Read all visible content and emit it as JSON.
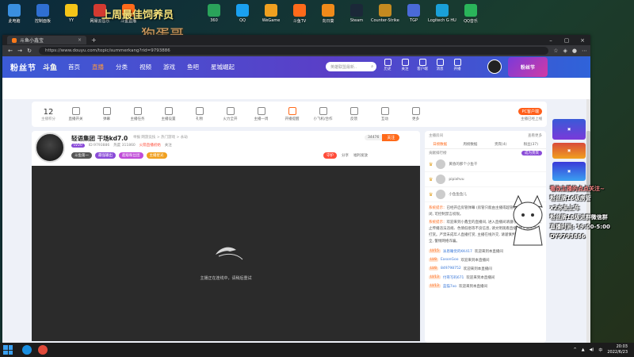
{
  "desktop": {
    "icons": [
      {
        "label": "此电脑",
        "color": "#3a8fe0"
      },
      {
        "label": "控制面板",
        "color": "#2f6fd1"
      },
      {
        "label": "YY",
        "color": "#f5c518"
      },
      {
        "label": "网易云音乐",
        "color": "#d33a31"
      },
      {
        "label": "斗鱼直播",
        "color": "#ff6a1a"
      },
      {
        "label": "",
        "color": "transparent"
      },
      {
        "label": "",
        "color": "transparent"
      },
      {
        "label": "360",
        "color": "#2aa35a"
      },
      {
        "label": "QQ",
        "color": "#1aa0f0"
      },
      {
        "label": "WeGame",
        "color": "#f0a020"
      },
      {
        "label": "斗鱼TV",
        "color": "#ff6a1a"
      },
      {
        "label": "向日葵",
        "color": "#f08a1a"
      },
      {
        "label": "Steam",
        "color": "#1b2838"
      },
      {
        "label": "Counter-Strike Global Off...",
        "color": "#c48a20"
      },
      {
        "label": "TGP",
        "color": "#4a6ad8"
      },
      {
        "label": "Logitech G HUB",
        "color": "#1aa0d8"
      },
      {
        "label": "QQ音乐",
        "color": "#2ab55a"
      }
    ],
    "banner_title": "上周最佳饲养员",
    "banner_name": "狗蛋哥"
  },
  "browser": {
    "tab_title": "斗鱼小鑫宝",
    "url": "https://www.douyu.com/topic/summerkang?rid=9793886",
    "nav_back": "←",
    "nav_forward": "→",
    "nav_reload": "↻"
  },
  "site": {
    "logo": "粉丝节",
    "logo2": "斗鱼",
    "nav": [
      "首页",
      "直播",
      "分类",
      "视频",
      "游戏",
      "鱼吧",
      "星城崛起"
    ],
    "search_placeholder": "英雄联盟最新..",
    "header_icons": [
      "历史",
      "关注",
      "客户端",
      "消息",
      "开播"
    ],
    "ad_text": "粉丝节"
  },
  "toolbar": {
    "count_value": "12",
    "count_label": "主播积分",
    "items": [
      "直播开关",
      "弹幕",
      "主播任务",
      "主播设置",
      "礼物",
      "火力全开",
      "主播一周",
      "开播提醒",
      "小飞机/合作",
      "反馈",
      "互动",
      "更多"
    ],
    "pc_client": "PC客户端",
    "pc_client_sub": "主播已经上线"
  },
  "player": {
    "title": "轻语集团 干场kd7.0",
    "category": "举报  网游竞技 > 热门游戏 > 永劫",
    "level": "LV20",
    "room_id": "ID:9793886",
    "popularity": "热度 311860",
    "rank": "火箭直播初始",
    "follow_text": "关注",
    "chip1": "斗鱼第一",
    "chip2": "最强输出",
    "chip3": "超级粉丝团",
    "chip4": "主播星光",
    "follow_count": "34476",
    "follow_btn": "关注",
    "gold_btn": "守护",
    "share": "分享",
    "report": "福利发放",
    "loading_text": "主播正在连线中，请稍后重试"
  },
  "chat": {
    "top_left": "主播房间",
    "top_right": "查看更多",
    "tabs": [
      "日榜数据",
      "周榜数据",
      "贵宾(4)",
      "粉丝(37)"
    ],
    "rank_header": "贡献排行榜",
    "rank_btn": "成为贵宾",
    "rank_rows": [
      "黄昏的那个小鱼干",
      "pipixhvu",
      "小鱼鱼鱼儿"
    ],
    "messages": [
      {
        "tag": "系统提示：",
        "text": "已经开启房管弹幕 (房管只能由主播或超管设置), 默认为关闭, 可控制禁言权限。"
      },
      {
        "tag": "系统提示：",
        "text": "欢迎来到小鑫宝的直播间, 进入直播间请遵守24小时监管, 禁止传播违法违规、色情低俗等不良信息, 请文明观看直播, 禁止未成年人打赏。严禁未成年人直播打赏, 主播在线外交, 请谨慎判断, 注意财产安全, 警惕网络诈骗。"
      }
    ],
    "welcomes": [
      {
        "lv": "LV15",
        "name": "泳恩睡觉的KK417",
        "text": "欢迎来到本直播间"
      },
      {
        "lv": "LV8",
        "name": "EasonGoo",
        "text": "欢迎来到本直播间"
      },
      {
        "lv": "LV8",
        "name": "849798752",
        "text": "欢迎来到本直播间"
      },
      {
        "lv": "LV13",
        "name": "付哥写码671",
        "text": "欢迎来到本直播间"
      },
      {
        "lv": "LV13",
        "name": "蓝猫7xo",
        "text": "欢迎来到本直播间"
      }
    ]
  },
  "overlay": {
    "line1": "看改主播的点点关注~",
    "line2": "粉丝牌16级房管",
    "line3": "x2水友上车",
    "line4": "粉丝牌18级进群微信群",
    "line5": "直播时间: 19:00-5:00",
    "line6": "DY9793886"
  },
  "taskbar": {
    "time": "20:03",
    "date": "2022/6/23",
    "lang": "中"
  },
  "colors": {
    "accent": "#ff6a1a",
    "header_blue": "#3b5bd6",
    "purple": "#8a4bd8"
  }
}
